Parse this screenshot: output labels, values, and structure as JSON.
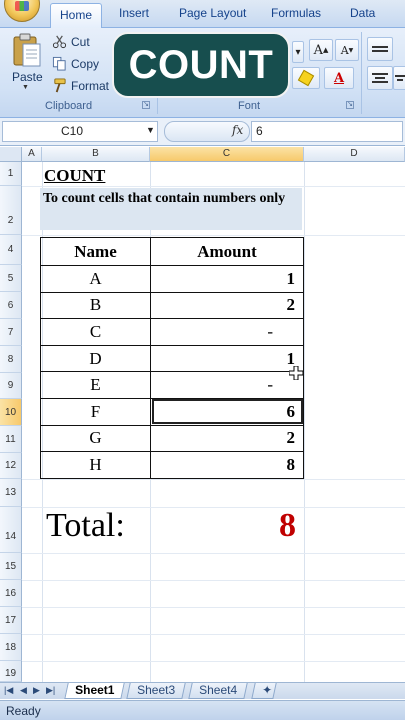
{
  "ribbon": {
    "tabs": [
      "Home",
      "Insert",
      "Page Layout",
      "Formulas",
      "Data"
    ],
    "clipboard": {
      "paste": "Paste",
      "cut": "Cut",
      "copy": "Copy",
      "format": "Format",
      "group_label": "Clipboard"
    },
    "font": {
      "group_label": "Font"
    },
    "icons": [
      "office-button-icon",
      "paste-icon",
      "scissors-icon",
      "copy-icon",
      "format-painter-icon",
      "dialog-launcher-icon"
    ]
  },
  "overlay": {
    "text": "COUNT"
  },
  "formula_bar": {
    "name_box": "C10",
    "fx": "fx",
    "formula": "6"
  },
  "columns": [
    "A",
    "B",
    "C",
    "D"
  ],
  "rows": [
    "1",
    "2",
    "4",
    "5",
    "6",
    "7",
    "8",
    "9",
    "10",
    "11",
    "12",
    "13",
    "14",
    "15",
    "16",
    "17",
    "18",
    "19"
  ],
  "sheet": {
    "title": "COUNT",
    "subtitle": "To count cells that contain numbers only",
    "table": {
      "headers": [
        "Name",
        "Amount"
      ],
      "rows": [
        {
          "name": "A",
          "amount": "1"
        },
        {
          "name": "B",
          "amount": "2"
        },
        {
          "name": "C",
          "amount": "-"
        },
        {
          "name": "D",
          "amount": "1"
        },
        {
          "name": "E",
          "amount": "-"
        },
        {
          "name": "F",
          "amount": "6"
        },
        {
          "name": "G",
          "amount": "2"
        },
        {
          "name": "H",
          "amount": "8"
        }
      ]
    },
    "total_label": "Total:",
    "total_value": "8"
  },
  "sheet_tabs": [
    "Sheet1",
    "Sheet3",
    "Sheet4"
  ],
  "active_sheet": "Sheet1",
  "status": "Ready",
  "colors": {
    "total_value": "#c00000",
    "overlay_bg": "#174e4e",
    "subtitle_fill": "#dce6f1"
  }
}
